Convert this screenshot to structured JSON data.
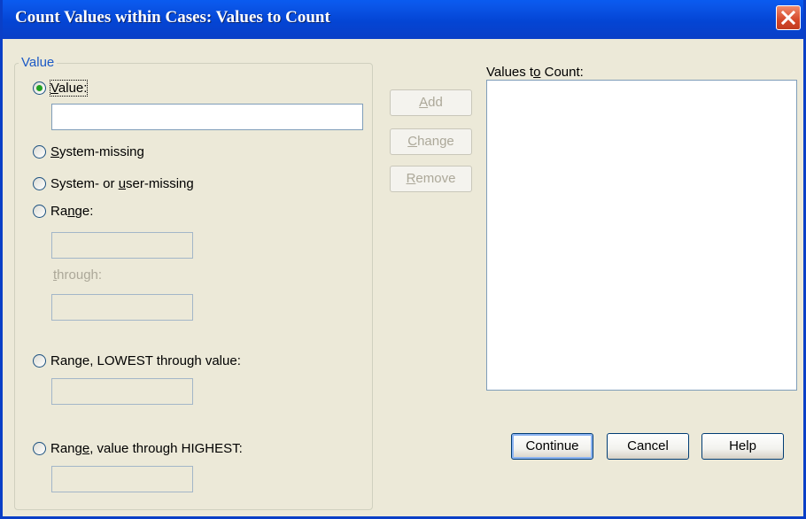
{
  "window": {
    "title": "Count Values within Cases: Values to Count"
  },
  "group": {
    "legend": "Value"
  },
  "options": {
    "value": {
      "prefix": "",
      "mnemonic": "V",
      "suffix": "alue:"
    },
    "system_missing": {
      "prefix": "",
      "mnemonic": "S",
      "suffix": "ystem-missing"
    },
    "system_or_user_missing": {
      "prefix": "System- or ",
      "mnemonic": "u",
      "suffix": "ser-missing"
    },
    "range": {
      "prefix": "Ra",
      "mnemonic": "n",
      "suffix": "ge:"
    },
    "range_lowest": {
      "prefix": "Ran",
      "mnemonic": "g",
      "suffix": "e, LOWEST through value:"
    },
    "range_highest": {
      "prefix": "Rang",
      "mnemonic": "e",
      "suffix": ", value through HIGHEST:"
    }
  },
  "selected_option": "value",
  "fields": {
    "value_input": "",
    "range_from": "",
    "range_to": "",
    "range_lowest_value": "",
    "range_highest_value": ""
  },
  "through_label": {
    "prefix": "",
    "mnemonic": "t",
    "suffix": "hrough:"
  },
  "list_buttons": {
    "add": {
      "prefix": "",
      "mnemonic": "A",
      "suffix": "dd"
    },
    "change": {
      "prefix": "",
      "mnemonic": "C",
      "suffix": "hange"
    },
    "remove": {
      "prefix": "",
      "mnemonic": "R",
      "suffix": "emove"
    }
  },
  "values_list": {
    "label_prefix": "Values t",
    "label_mnemonic": "o",
    "label_suffix": " Count:",
    "items": []
  },
  "footer": {
    "continue": "Continue",
    "cancel": "Cancel",
    "help": "Help"
  },
  "colors": {
    "titlebar": "#0a5bf0",
    "dialog_bg": "#ece9d8",
    "group_legend": "#1c5ac6",
    "radio_dot": "#21a121",
    "close_button": "#d5482a"
  }
}
